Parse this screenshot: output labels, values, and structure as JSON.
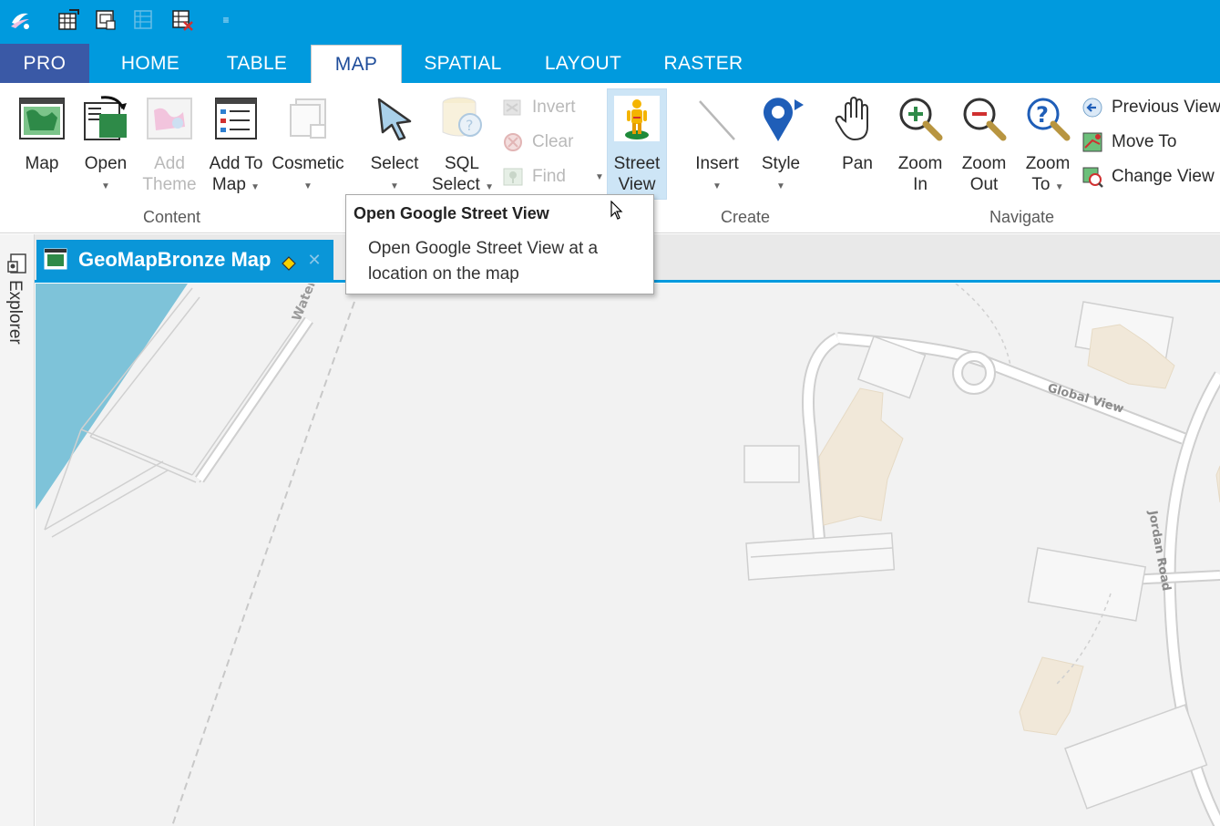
{
  "quick_access": {
    "icons": [
      "app-logo-icon",
      "new-table-icon",
      "open-workspace-icon",
      "save-table-icon",
      "close-table-icon",
      "qat-customize-icon"
    ]
  },
  "tabs": {
    "pro": "PRO",
    "items": [
      {
        "label": "HOME"
      },
      {
        "label": "TABLE"
      },
      {
        "label": "MAP",
        "active": true
      },
      {
        "label": "SPATIAL"
      },
      {
        "label": "LAYOUT"
      },
      {
        "label": "RASTER"
      }
    ]
  },
  "ribbon": {
    "content": {
      "map": "Map",
      "open": "Open",
      "add_theme_1": "Add",
      "add_theme_2": "Theme",
      "add_to_map_1": "Add To",
      "add_to_map_2": "Map",
      "cosmetic": "Cosmetic",
      "group": "Content"
    },
    "selection": {
      "select": "Select",
      "sql_1": "SQL",
      "sql_2": "Select",
      "invert": "Invert",
      "clear": "Clear",
      "find": "Find",
      "street_1": "Street",
      "street_2": "View"
    },
    "create": {
      "insert": "Insert",
      "style": "Style",
      "group": "Create"
    },
    "navigate": {
      "pan": "Pan",
      "zoom_in_1": "Zoom",
      "zoom_in_2": "In",
      "zoom_out_1": "Zoom",
      "zoom_out_2": "Out",
      "zoom_to_1": "Zoom",
      "zoom_to_2": "To",
      "previous_view": "Previous View",
      "move_to": "Move To",
      "change_view": "Change View",
      "group": "Navigate"
    }
  },
  "explorer": {
    "label": "Explorer"
  },
  "document": {
    "tab_title": "GeoMapBronze Map"
  },
  "map": {
    "labels": {
      "water": "Water",
      "global_view": "Global View",
      "jordan_road": "Jordan Road"
    },
    "colors": {
      "background": "#f2f2f2",
      "water": "#7ec3d9",
      "building": "#f1e8d9",
      "road": "#ffffff",
      "road_outline": "#cfcfcf"
    }
  },
  "tooltip": {
    "title": "Open Google Street View",
    "body": "Open Google Street View at a location on the map"
  },
  "colors": {
    "accent": "#009ade",
    "pro_tab": "#3a59a6",
    "active_tab_text": "#1e4c9a"
  }
}
